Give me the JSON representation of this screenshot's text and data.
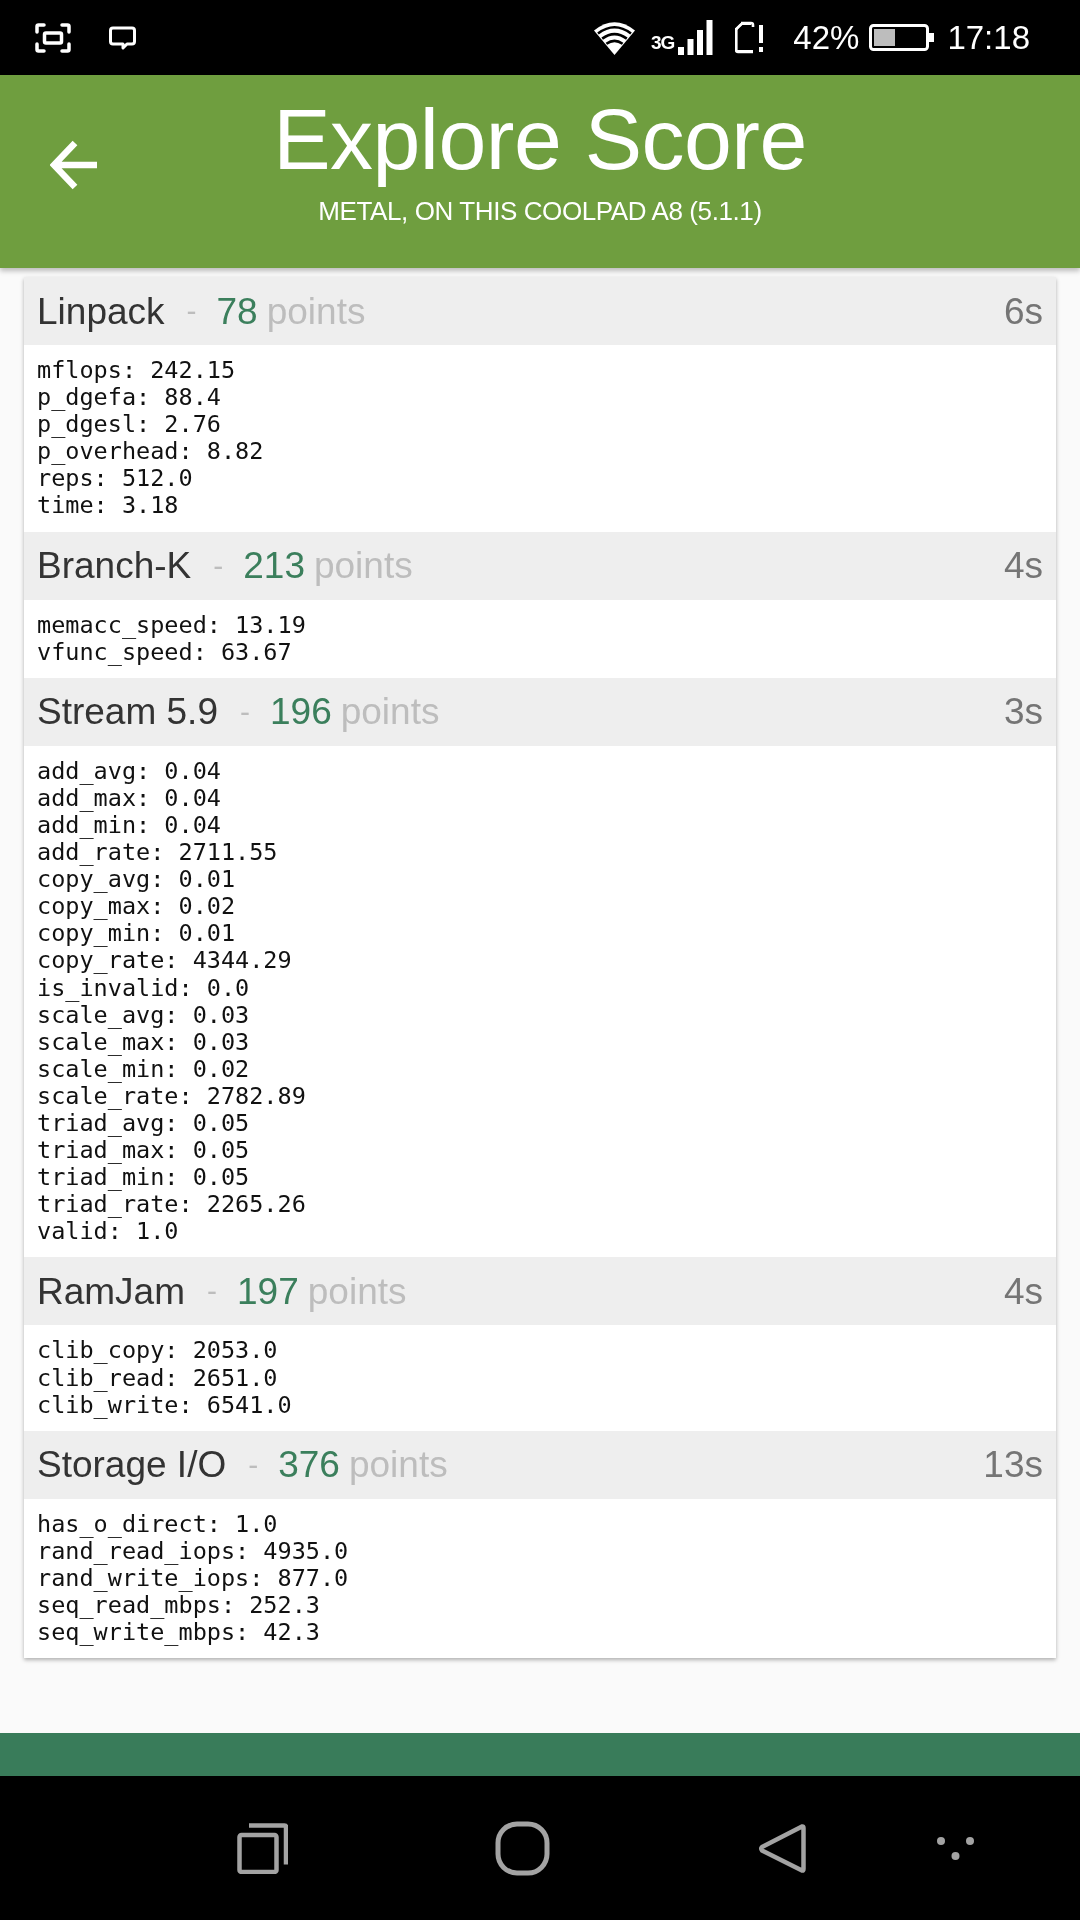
{
  "status_bar": {
    "network": "3G",
    "battery": "42%",
    "time": "17:18"
  },
  "app_bar": {
    "title": "Explore Score",
    "subtitle": "METAL, ON THIS COOLPAD A8 (5.1.1)"
  },
  "benchmarks": [
    {
      "name": "Linpack",
      "separator": "-",
      "score": "78",
      "unit": "points",
      "duration": "6s",
      "results": [
        "mflops: 242.15",
        "p_dgefa: 88.4",
        "p_dgesl: 2.76",
        "p_overhead: 8.82",
        "reps: 512.0",
        "time: 3.18"
      ]
    },
    {
      "name": "Branch-K",
      "separator": "-",
      "score": "213",
      "unit": "points",
      "duration": "4s",
      "results": [
        "memacc_speed: 13.19",
        "vfunc_speed: 63.67"
      ]
    },
    {
      "name": "Stream 5.9",
      "separator": "-",
      "score": "196",
      "unit": "points",
      "duration": "3s",
      "results": [
        "add_avg: 0.04",
        "add_max: 0.04",
        "add_min: 0.04",
        "add_rate: 2711.55",
        "copy_avg: 0.01",
        "copy_max: 0.02",
        "copy_min: 0.01",
        "copy_rate: 4344.29",
        "is_invalid: 0.0",
        "scale_avg: 0.03",
        "scale_max: 0.03",
        "scale_min: 0.02",
        "scale_rate: 2782.89",
        "triad_avg: 0.05",
        "triad_max: 0.05",
        "triad_min: 0.05",
        "triad_rate: 2265.26",
        "valid: 1.0"
      ]
    },
    {
      "name": "RamJam",
      "separator": "-",
      "score": "197",
      "unit": "points",
      "duration": "4s",
      "results": [
        "clib_copy: 2053.0",
        "clib_read: 2651.0",
        "clib_write: 6541.0"
      ]
    },
    {
      "name": "Storage I/O",
      "separator": "-",
      "score": "376",
      "unit": "points",
      "duration": "13s",
      "results": [
        "has_o_direct: 1.0",
        "rand_read_iops: 4935.0",
        "rand_write_iops: 877.0",
        "seq_read_mbps: 252.3",
        "seq_write_mbps: 42.3"
      ]
    }
  ]
}
